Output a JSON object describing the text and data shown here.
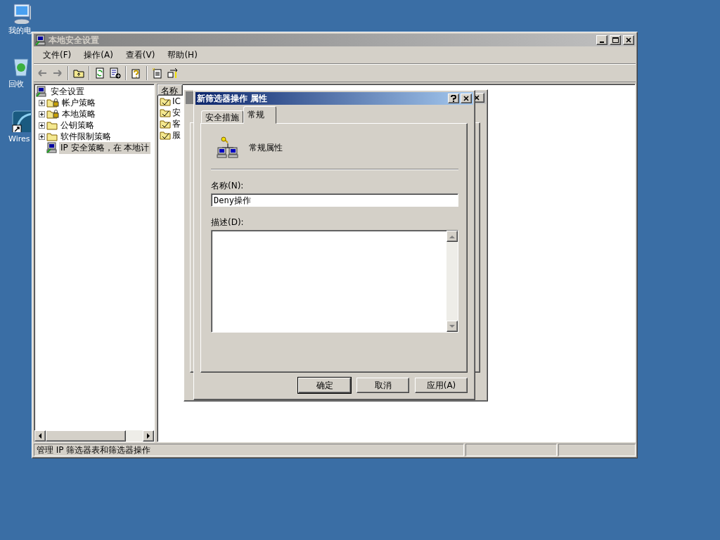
{
  "desktop_icons": [
    {
      "label": "我的电",
      "kind": "computer"
    },
    {
      "label": "回收",
      "kind": "recycle"
    },
    {
      "label": "Wires",
      "kind": "shortcut"
    }
  ],
  "main_window": {
    "title": "本地安全设置",
    "active": false,
    "menu": [
      "文件(F)",
      "操作(A)",
      "查看(V)",
      "帮助(H)"
    ],
    "tree": {
      "root": "安全设置",
      "items": [
        {
          "label": "帐户策略",
          "kind": "lock-folder",
          "expanded": false,
          "selected": false
        },
        {
          "label": "本地策略",
          "kind": "lock-folder",
          "expanded": false,
          "selected": false
        },
        {
          "label": "公钥策略",
          "kind": "folder",
          "expanded": false,
          "selected": false
        },
        {
          "label": "软件限制策略",
          "kind": "folder",
          "expanded": false,
          "selected": false
        },
        {
          "label": "IP 安全策略，在 本地计",
          "kind": "computer",
          "selected": true
        }
      ]
    },
    "list": {
      "columns": [
        "名称"
      ],
      "rows": [
        "IC",
        "安",
        "客",
        "服"
      ]
    },
    "status_bar": {
      "text": "管理 IP 筛选器表和筛选器操作"
    }
  },
  "dialog": {
    "title": "新筛选器操作 属性",
    "active": true,
    "tabs": [
      {
        "label": "安全措施",
        "selected": false
      },
      {
        "label": "常规",
        "selected": true
      }
    ],
    "heading": "常规属性",
    "name_label": "名称(N):",
    "name_value": "Deny操作",
    "description_label": "描述(D):",
    "buttons": [
      {
        "label": "确定",
        "default": true
      },
      {
        "label": "取消",
        "default": false
      },
      {
        "label": "应用(A)",
        "default": false
      }
    ]
  }
}
